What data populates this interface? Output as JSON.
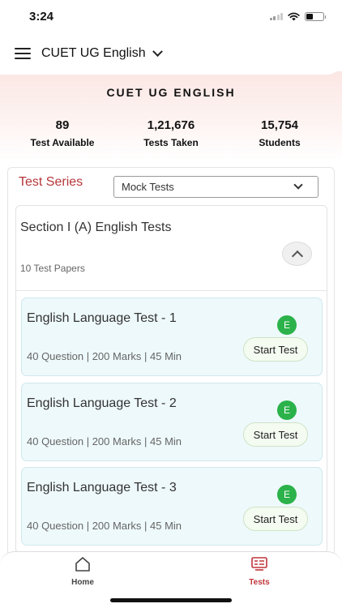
{
  "status_bar": {
    "time": "3:24"
  },
  "header": {
    "title": "CUET UG English"
  },
  "hero": {
    "title": "CUET UG ENGLISH",
    "stats": [
      {
        "value": "89",
        "label": "Test Available"
      },
      {
        "value": "1,21,676",
        "label": "Tests Taken"
      },
      {
        "value": "15,754",
        "label": "Students"
      }
    ]
  },
  "series": {
    "label": "Test Series",
    "selected": "Mock Tests"
  },
  "section": {
    "title": "Section I (A) English Tests",
    "subtitle": "10 Test Papers"
  },
  "tests": [
    {
      "title": "English Language Test - 1",
      "meta": "40 Question |  200 Marks | 45 Min",
      "badge": "E",
      "button": "Start Test"
    },
    {
      "title": "English Language Test - 2",
      "meta": "40 Question |  200 Marks | 45 Min",
      "badge": "E",
      "button": "Start Test"
    },
    {
      "title": "English Language Test - 3",
      "meta": "40 Question |  200 Marks | 45 Min",
      "badge": "E",
      "button": "Start Test"
    }
  ],
  "bottom_nav": {
    "home_label": "Home",
    "tests_label": "Tests"
  },
  "colors": {
    "accent_red": "#c0353b",
    "badge_green": "#2bb24a",
    "card_bg": "#eef9fb"
  }
}
